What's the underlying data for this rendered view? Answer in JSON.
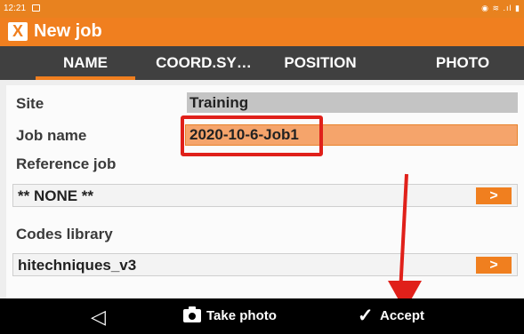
{
  "status": {
    "time": "12:21",
    "icons": "◉ ≋ .ıl ▮"
  },
  "header": {
    "logo": "X",
    "title": "New job"
  },
  "tabs": [
    {
      "label": "NAME"
    },
    {
      "label": "COORD.SY…"
    },
    {
      "label": "POSITION"
    },
    {
      "label": "PHOTO"
    }
  ],
  "form": {
    "site_label": "Site",
    "site_value": "Training",
    "jobname_label": "Job name",
    "jobname_value": "2020-10-6-Job1",
    "refjob_label": "Reference job",
    "refjob_value": "** NONE **",
    "codes_label": "Codes library",
    "codes_value": "hitechniques_v3",
    "select_button": ">"
  },
  "nav": {
    "back_icon": "◁",
    "take_photo_label": "Take photo",
    "check_icon": "✓",
    "accept_label": "Accept"
  },
  "colors": {
    "accent": "#f07f1f",
    "tab_bar": "#404040",
    "highlight": "#e0201a"
  }
}
